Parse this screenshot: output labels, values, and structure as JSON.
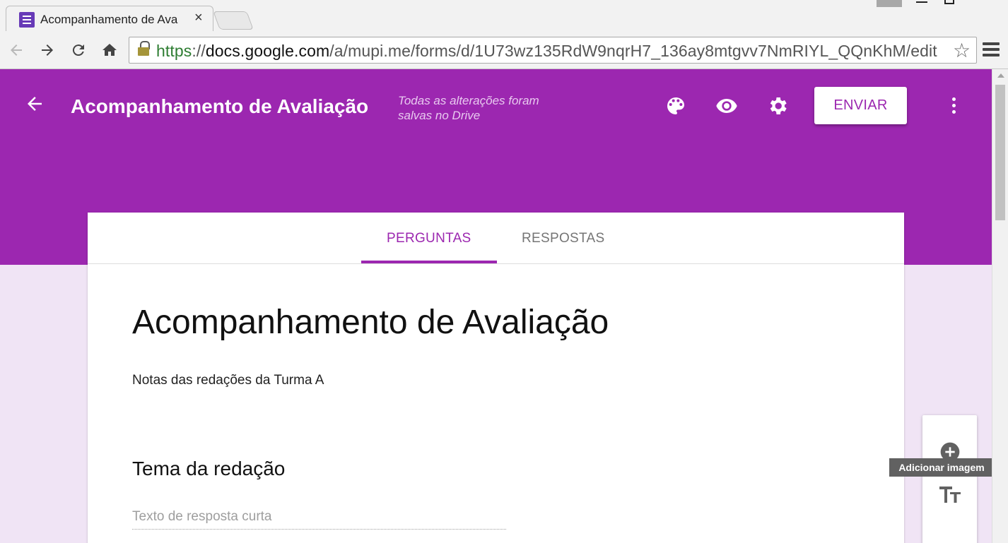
{
  "browser": {
    "tab_title": "Acompanhamento de Ava",
    "tab_close": "×",
    "url_scheme": "https",
    "url_sep": "://",
    "url_host": "docs.google.com",
    "url_path": "/a/mupi.me/forms/d/1U73wz135RdW9nqrH7_136ay8mtgvv7NmRIYL_QQnKhM/edit"
  },
  "header": {
    "title": "Acompanhamento de Avaliação",
    "save_status": "Todas as alterações foram salvas no Drive",
    "send_label": "ENVIAR"
  },
  "tabs": {
    "questions": "PERGUNTAS",
    "responses": "RESPOSTAS"
  },
  "form": {
    "title": "Acompanhamento de Avaliação",
    "description": "Notas das redações da Turma A",
    "question_title": "Tema da redação",
    "answer_placeholder": "Texto de resposta curta"
  },
  "tooltip": "Adicionar imagem",
  "colors": {
    "brand": "#9c27b0",
    "background": "#f0e4f5"
  }
}
